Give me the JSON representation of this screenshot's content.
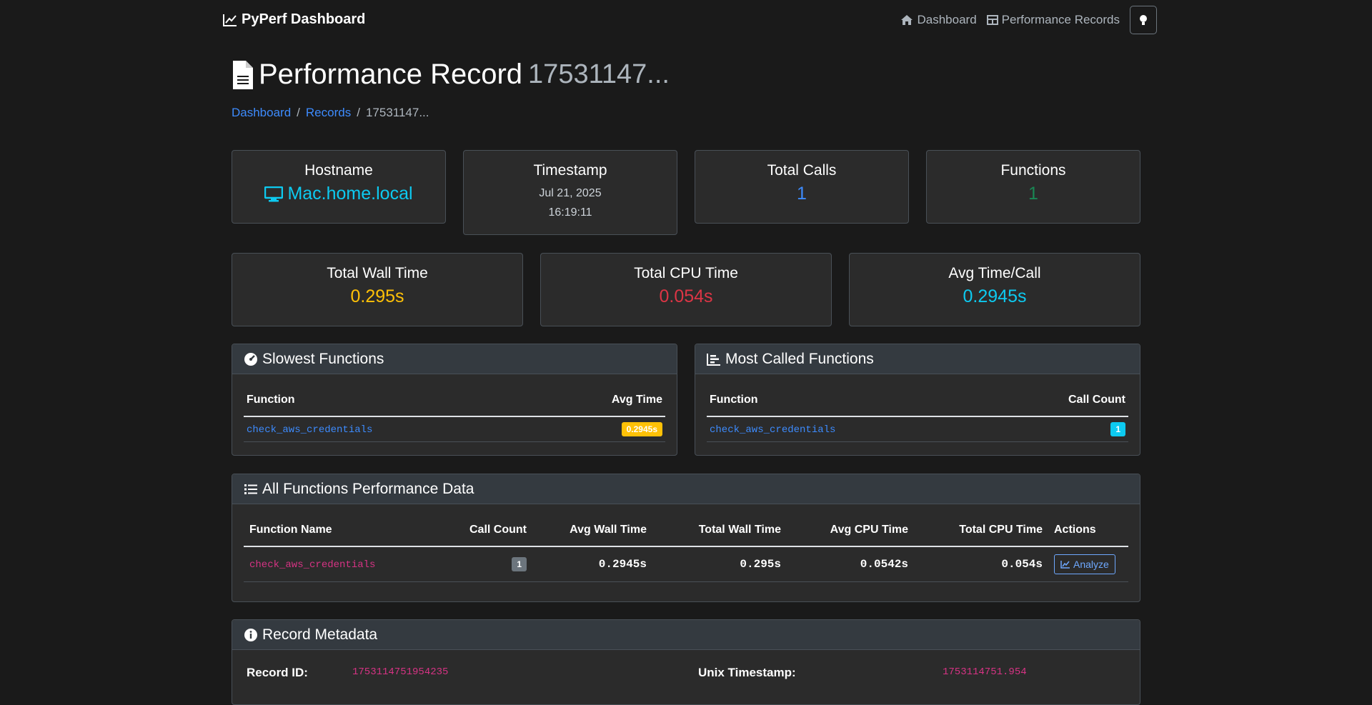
{
  "nav": {
    "brand": "PyPerf Dashboard",
    "links": [
      "Dashboard",
      "Performance Records"
    ]
  },
  "page": {
    "title": "Performance Record",
    "record_short": "17531147...",
    "breadcrumb": [
      "Dashboard",
      "Records",
      "17531147..."
    ]
  },
  "stats": {
    "hostname": {
      "label": "Hostname",
      "value": "Mac.home.local"
    },
    "timestamp": {
      "label": "Timestamp",
      "date": "Jul 21, 2025",
      "time": "16:19:11"
    },
    "total_calls": {
      "label": "Total Calls",
      "value": "1"
    },
    "functions": {
      "label": "Functions",
      "value": "1"
    },
    "wall": {
      "label": "Total Wall Time",
      "value": "0.295s"
    },
    "cpu": {
      "label": "Total CPU Time",
      "value": "0.054s"
    },
    "avg": {
      "label": "Avg Time/Call",
      "value": "0.2945s"
    }
  },
  "slowest": {
    "title": "Slowest Functions",
    "headers": [
      "Function",
      "Avg Time"
    ],
    "rows": [
      {
        "name": "check_aws_credentials",
        "value": "0.2945s"
      }
    ]
  },
  "most_called": {
    "title": "Most Called Functions",
    "headers": [
      "Function",
      "Call Count"
    ],
    "rows": [
      {
        "name": "check_aws_credentials",
        "value": "1"
      }
    ]
  },
  "all_functions": {
    "title": "All Functions Performance Data",
    "headers": [
      "Function Name",
      "Call Count",
      "Avg Wall Time",
      "Total Wall Time",
      "Avg CPU Time",
      "Total CPU Time",
      "Actions"
    ],
    "rows": [
      {
        "name": "check_aws_credentials",
        "calls": "1",
        "avg_wall": "0.2945s",
        "total_wall": "0.295s",
        "avg_cpu": "0.0542s",
        "total_cpu": "0.054s",
        "action": "Analyze"
      }
    ]
  },
  "metadata": {
    "title": "Record Metadata",
    "record_id_label": "Record ID:",
    "record_id_value": "1753114751954235",
    "unix_label": "Unix Timestamp:",
    "unix_value": "1753114751.954"
  },
  "colors": {
    "warning": "#ffc107",
    "danger": "#dc3545",
    "info": "#0dcaf0",
    "success": "#198754",
    "primary": "#3d8bfd"
  }
}
